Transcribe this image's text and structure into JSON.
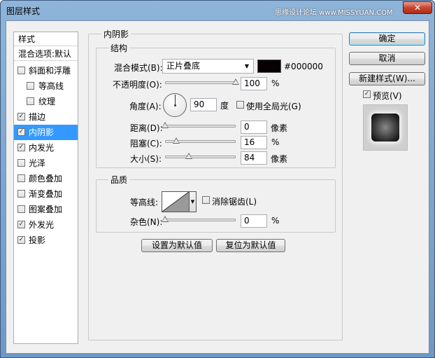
{
  "window": {
    "title": "图层样式",
    "watermark": "思缘设计论坛 www.MISSYUAN.COM",
    "close_glyph": "✕"
  },
  "sidebar": {
    "header_styles": "样式",
    "header_blending": "混合选项:默认",
    "items": [
      {
        "label": "斜面和浮雕",
        "checked": false,
        "indent": false,
        "selected": false
      },
      {
        "label": "等高线",
        "checked": false,
        "indent": true,
        "selected": false
      },
      {
        "label": "纹理",
        "checked": false,
        "indent": true,
        "selected": false
      },
      {
        "label": "描边",
        "checked": true,
        "indent": false,
        "selected": false
      },
      {
        "label": "内阴影",
        "checked": true,
        "indent": false,
        "selected": true
      },
      {
        "label": "内发光",
        "checked": true,
        "indent": false,
        "selected": false
      },
      {
        "label": "光泽",
        "checked": false,
        "indent": false,
        "selected": false
      },
      {
        "label": "颜色叠加",
        "checked": false,
        "indent": false,
        "selected": false
      },
      {
        "label": "渐变叠加",
        "checked": false,
        "indent": false,
        "selected": false
      },
      {
        "label": "图案叠加",
        "checked": false,
        "indent": false,
        "selected": false
      },
      {
        "label": "外发光",
        "checked": true,
        "indent": false,
        "selected": false
      },
      {
        "label": "投影",
        "checked": true,
        "indent": false,
        "selected": false
      }
    ]
  },
  "panel": {
    "title": "内阴影",
    "structure": {
      "title": "结构",
      "blend_mode_label": "混合模式(B):",
      "blend_mode_value": "正片叠底",
      "color_hex": "#000000",
      "color_swatch": "#060003",
      "opacity_label": "不透明度(O):",
      "opacity_value": "100",
      "opacity_unit": "%",
      "opacity_fraction": 1.0,
      "angle_label": "角度(A):",
      "angle_value": "90",
      "angle_unit": "度",
      "global_light_label": "使用全局光(G)",
      "global_light_checked": false,
      "distance_label": "距离(D):",
      "distance_value": "0",
      "distance_unit": "像素",
      "distance_fraction": 0.0,
      "choke_label": "阻塞(C):",
      "choke_value": "16",
      "choke_unit": "%",
      "choke_fraction": 0.16,
      "size_label": "大小(S):",
      "size_value": "84",
      "size_unit": "像素",
      "size_fraction": 0.34
    },
    "quality": {
      "title": "品质",
      "contour_label": "等高线:",
      "antialias_label": "消除锯齿(L)",
      "antialias_checked": false,
      "noise_label": "杂色(N):",
      "noise_value": "0",
      "noise_unit": "%",
      "noise_fraction": 0.0
    },
    "set_default_button": "设置为默认值",
    "reset_default_button": "复位为默认值"
  },
  "buttons": {
    "ok": "确定",
    "cancel": "取消",
    "new_style": "新建样式(W)...",
    "preview_label": "预览(V)",
    "preview_checked": true
  },
  "icons": {
    "check": "✓",
    "dropdown": "▼"
  }
}
